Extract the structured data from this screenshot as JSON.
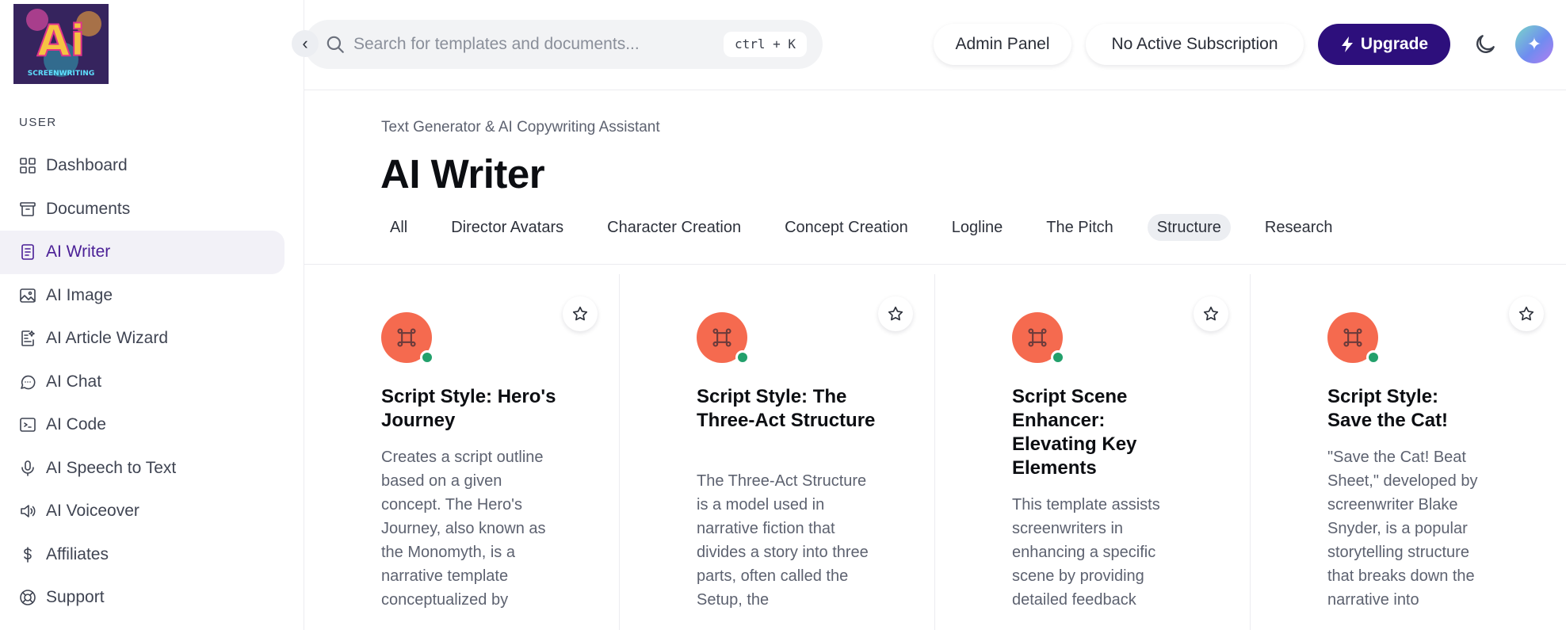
{
  "logo": {
    "text_big": "Ai",
    "text_small": "SCREENWRITING"
  },
  "sidebar": {
    "section_label": "USER",
    "items": [
      {
        "label": "Dashboard",
        "icon": "grid-icon"
      },
      {
        "label": "Documents",
        "icon": "archive-icon"
      },
      {
        "label": "AI Writer",
        "icon": "document-icon",
        "active": true
      },
      {
        "label": "AI Image",
        "icon": "image-icon"
      },
      {
        "label": "AI Article Wizard",
        "icon": "wizard-icon"
      },
      {
        "label": "AI Chat",
        "icon": "chat-icon"
      },
      {
        "label": "AI Code",
        "icon": "terminal-icon"
      },
      {
        "label": "AI Speech to Text",
        "icon": "microphone-icon"
      },
      {
        "label": "AI Voiceover",
        "icon": "speaker-icon"
      },
      {
        "label": "Affiliates",
        "icon": "dollar-icon"
      },
      {
        "label": "Support",
        "icon": "lifebuoy-icon"
      }
    ]
  },
  "header": {
    "search_placeholder": "Search for templates and documents...",
    "shortcut": "ctrl + K",
    "admin_panel": "Admin Panel",
    "subscription": "No Active Subscription",
    "upgrade": "Upgrade",
    "accent_color": "#2d0f7c"
  },
  "page": {
    "subtitle": "Text Generator & AI Copywriting Assistant",
    "title": "AI Writer",
    "tabs": [
      "All",
      "Director Avatars",
      "Character Creation",
      "Concept Creation",
      "Logline",
      "The Pitch",
      "Structure",
      "Research"
    ],
    "active_tab": "Structure"
  },
  "cards": [
    {
      "title": "Script Style: Hero's Journey",
      "description": "Creates a script outline based on a given concept. The Hero's Journey, also known as the Monomyth, is a narrative template conceptualized by"
    },
    {
      "title": "Script Style: The Three-Act Structure",
      "description": "The Three-Act Structure is a model used in narrative fiction that divides a story into three parts, often called the Setup, the"
    },
    {
      "title": "Script Scene Enhancer: Elevating Key Elements",
      "description": "This template assists screenwriters in enhancing a specific scene by providing detailed feedback"
    },
    {
      "title": "Script Style: Save the Cat!",
      "description": "\"Save the Cat! Beat Sheet,\" developed by screenwriter Blake Snyder, is a popular storytelling structure that breaks down the narrative into"
    }
  ]
}
